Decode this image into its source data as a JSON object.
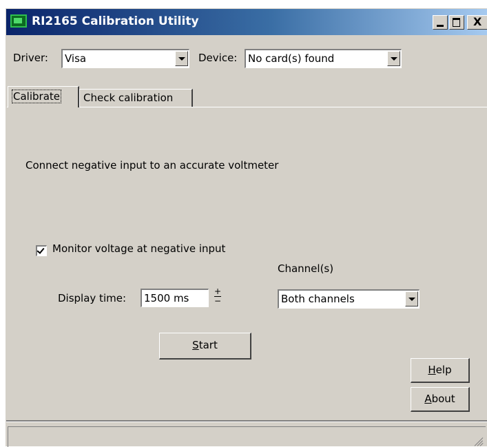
{
  "window": {
    "title": "RI2165 Calibration Utility",
    "controls": {
      "minimize": "_",
      "maximize": "□",
      "close": "X"
    }
  },
  "top_bar": {
    "driver_label": "Driver:",
    "driver_value": "Visa",
    "device_label": "Device:",
    "device_value": "No card(s) found"
  },
  "tabs": [
    {
      "label": "Calibrate",
      "selected": true
    },
    {
      "label": "Check calibration",
      "selected": false
    }
  ],
  "calibrate_panel": {
    "instruction": "Connect negative input to an accurate voltmeter",
    "monitor_checkbox": {
      "label": "Monitor voltage at negative input",
      "checked": true
    },
    "display_time_label": "Display time:",
    "display_time_value": "1500 ms",
    "channels_label": "Channel(s)",
    "channels_value": "Both channels",
    "start_button": {
      "prefix": "",
      "accel": "S",
      "rest": "tart"
    },
    "help_button": {
      "accel": "H",
      "rest": "elp"
    },
    "about_button": {
      "accel": "A",
      "rest": "bout"
    }
  },
  "status_bar": {
    "text": ""
  },
  "colors": {
    "face": "#d4d0c8",
    "titlebar_start": "#0a246a",
    "titlebar_end": "#a6caf0",
    "icon": "#0c6a22"
  }
}
